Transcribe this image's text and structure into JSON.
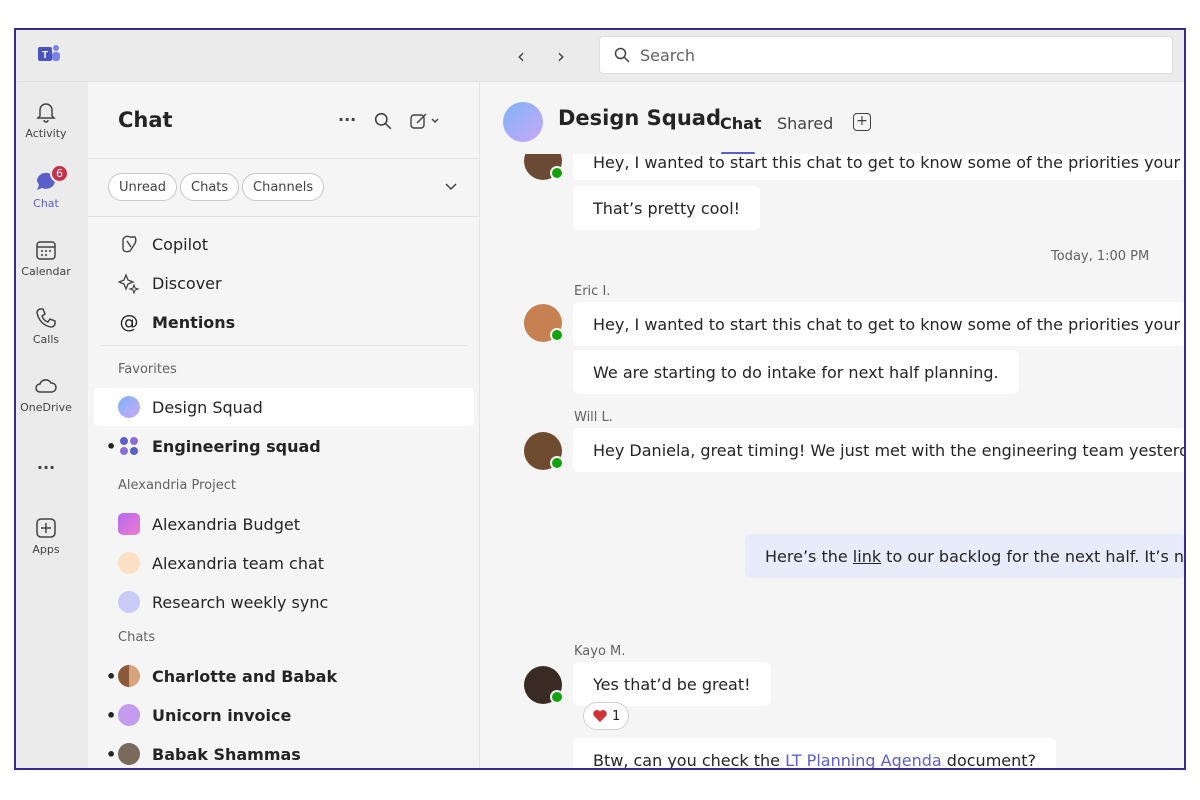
{
  "search": {
    "placeholder": "Search"
  },
  "rail": {
    "items": [
      {
        "label": "Activity"
      },
      {
        "label": "Chat",
        "badge": "6"
      },
      {
        "label": "Calendar"
      },
      {
        "label": "Calls"
      },
      {
        "label": "OneDrive"
      },
      {
        "label": "..."
      },
      {
        "label": "Apps"
      }
    ]
  },
  "list": {
    "title": "Chat",
    "filters": [
      "Unread",
      "Chats",
      "Channels"
    ],
    "top_items": [
      "Copilot",
      "Discover",
      "Mentions"
    ],
    "sections": {
      "favorites": "Favorites",
      "project": "Alexandria Project",
      "chats": "Chats"
    },
    "favorites": [
      {
        "label": "Design Squad",
        "selected": true
      },
      {
        "label": "Engineering squad",
        "unread": true
      }
    ],
    "project_items": [
      "Alexandria Budget",
      "Alexandria team chat",
      "Research weekly sync"
    ],
    "chats": [
      "Charlotte and Babak",
      "Unicorn invoice",
      "Babak Shammas"
    ]
  },
  "chat": {
    "title": "Design Squad",
    "tabs": [
      "Chat",
      "Shared"
    ],
    "messages": {
      "m0": "Hey, I wanted to start this chat to get to know some of the priorities your guys",
      "m1": "That’s pretty cool!",
      "timestamp": "Today, 1:00 PM",
      "eric": "Eric I.",
      "m2": "Hey, I wanted to start this chat to get to know some of the priorities your guys",
      "m3": "We are starting to do intake for next half planning.",
      "will": "Will L.",
      "m4": "Hey Daniela, great timing! We just met with the engineering team yesterday.",
      "m5_pre": "Here’s the ",
      "m5_link": "link",
      "m5_post": " to our backlog for the next half. It’s not lo",
      "kayo": "Kayo M.",
      "m6": "Yes that’d be great!",
      "reaction_count": "1",
      "m7_pre": "Btw, can you check the ",
      "m7_link": "LT Planning Agenda",
      "m7_post": " document?"
    }
  },
  "colors": {
    "accent": "#5b5fc7",
    "frame": "#3b2a8c",
    "badge": "#c4314b",
    "presence": "#13a10e"
  }
}
